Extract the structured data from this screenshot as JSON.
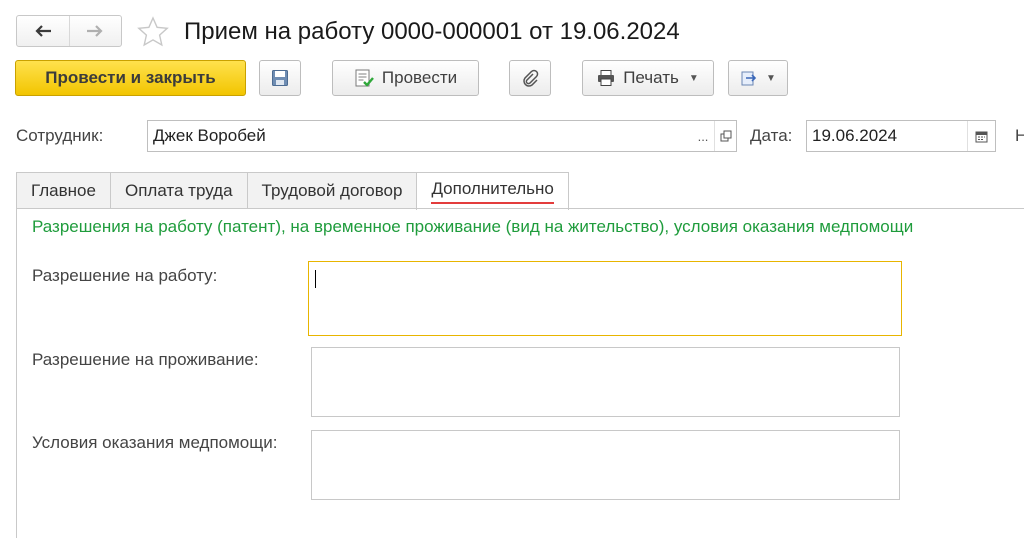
{
  "window": {
    "title": "Прием на работу 0000-000001 от 19.06.2024"
  },
  "nav": {
    "back_icon": "arrow-left-icon",
    "forward_icon": "arrow-right-icon",
    "favorite_icon": "star-icon"
  },
  "toolbar": {
    "post_and_close_label": "Провести и закрыть",
    "save_icon": "floppy-disk-icon",
    "post_label": "Провести",
    "attach_icon": "paperclip-icon",
    "print_label": "Печать",
    "more_icon": "export-icon"
  },
  "header_fields": {
    "employee_label": "Сотрудник:",
    "employee_value": "Джек Воробей",
    "date_label": "Дата:",
    "date_value": "19.06.2024",
    "clipped_label": "Н"
  },
  "tabs": [
    {
      "label": "Главное",
      "active": false
    },
    {
      "label": "Оплата труда",
      "active": false
    },
    {
      "label": "Трудовой договор",
      "active": false
    },
    {
      "label": "Дополнительно",
      "active": true
    }
  ],
  "additional": {
    "group_title": "Разрешения на работу (патент), на временное проживание (вид на жительство), условия оказания медпомощи",
    "work_permit_label": "Разрешение на работу:",
    "work_permit_value": "",
    "residence_permit_label": "Разрешение на проживание:",
    "residence_permit_value": "",
    "medical_terms_label": "Условия оказания медпомощи:",
    "medical_terms_value": ""
  },
  "colors": {
    "primary_button": "#f2c500",
    "group_title": "#1f9c3c",
    "active_tab_underline": "#e33c3c",
    "focus_border": "#e8b500"
  }
}
